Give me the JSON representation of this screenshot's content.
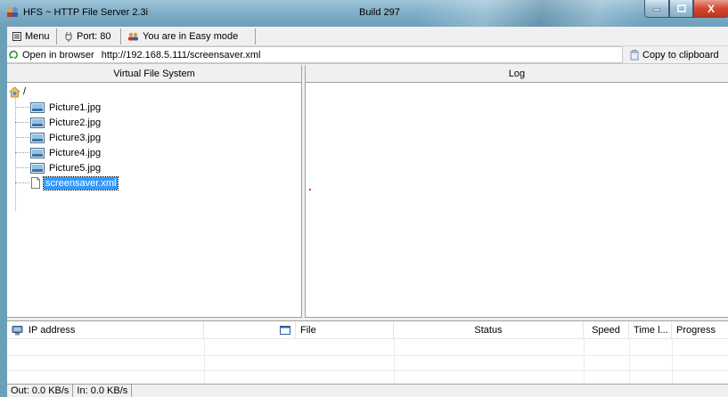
{
  "window": {
    "title": "HFS ~ HTTP File Server 2.3i",
    "build": "Build 297",
    "close_glyph": "X"
  },
  "menubar": {
    "menu_label": "Menu",
    "port_label": "Port: 80",
    "mode_label": "You are in Easy mode"
  },
  "address": {
    "open_label": "Open in browser",
    "url": "http://192.168.5.111/screensaver.xml",
    "copy_label": "Copy to clipboard"
  },
  "panels": {
    "vfs_title": "Virtual File System",
    "log_title": "Log"
  },
  "vfs": {
    "root": "/",
    "items": [
      {
        "name": "Picture1.jpg",
        "icon": "image-file-icon"
      },
      {
        "name": "Picture2.jpg",
        "icon": "image-file-icon"
      },
      {
        "name": "Picture3.jpg",
        "icon": "image-file-icon"
      },
      {
        "name": "Picture4.jpg",
        "icon": "image-file-icon"
      },
      {
        "name": "Picture5.jpg",
        "icon": "image-file-icon"
      },
      {
        "name": "screensaver.xml",
        "icon": "blank-file-icon",
        "selected": true
      }
    ]
  },
  "connections": {
    "columns": [
      "IP address",
      "File",
      "Status",
      "Speed",
      "Time l...",
      "Progress"
    ]
  },
  "status": {
    "out": "Out: 0.0 KB/s",
    "in": "In: 0.0 KB/s"
  }
}
